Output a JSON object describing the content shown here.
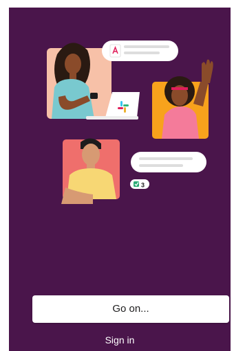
{
  "onboarding": {
    "chat_badge_count": "3",
    "primary_button_label": "Go on...",
    "secondary_link_label": "Sign in"
  },
  "icons": {
    "file_message": "pdf-file-icon",
    "laptop_logo": "slack-logo-icon",
    "badge_check": "checkmark-icon"
  },
  "colors": {
    "background": "#4a154b",
    "button_bg": "#ffffff",
    "button_text": "#1d1c1d",
    "link_text": "#ffffff",
    "badge_green": "#2bac76"
  }
}
